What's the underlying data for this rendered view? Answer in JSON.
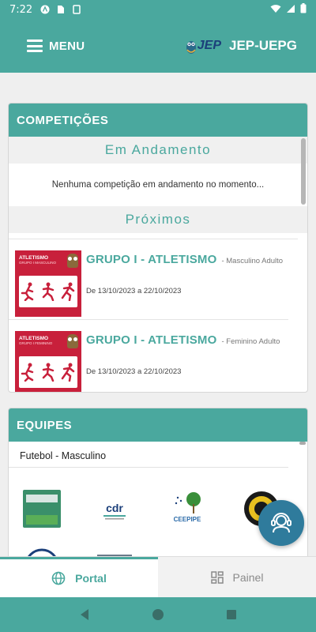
{
  "status_bar": {
    "time": "7:22"
  },
  "header": {
    "menu_label": "MENU",
    "logo_text": "JEP",
    "app_name": "JEP-UEPG"
  },
  "competicoes": {
    "title": "COMPETIÇÕES",
    "em_andamento": {
      "title": "Em Andamento",
      "empty_message": "Nenhuma competição em andamento no momento..."
    },
    "proximos": {
      "title": "Próximos",
      "items": [
        {
          "title": "GRUPO I - ATLETISMO",
          "category": "- Masculino Adulto",
          "dates": "De 13/10/2023 a 22/10/2023",
          "thumb_title": "ATLETISMO",
          "thumb_sub": "GRUPO I MASCULINO"
        },
        {
          "title": "GRUPO I - ATLETISMO",
          "category": "- Feminino Adulto",
          "dates": "De 13/10/2023 a 22/10/2023",
          "thumb_title": "ATLETISMO",
          "thumb_sub": "GRUPO I FEMININO"
        }
      ]
    }
  },
  "equipes": {
    "title": "EQUIPES",
    "category": "Futebol - Masculino",
    "team_logos": [
      {
        "name": "team-logo-building"
      },
      {
        "name": "team-logo-cdr",
        "text": "cdr"
      },
      {
        "name": "team-logo-ceepipe",
        "text": "CEEPIPE"
      },
      {
        "name": "team-logo-emblem"
      },
      {
        "name": "team-logo-seal"
      },
      {
        "name": "team-logo-stadium"
      }
    ]
  },
  "tabs": [
    {
      "label": "Portal",
      "icon": "globe-icon",
      "active": true
    },
    {
      "label": "Painel",
      "icon": "dashboard-icon",
      "active": false
    }
  ],
  "colors": {
    "primary": "#4aa89e",
    "thumb_red": "#c8203b",
    "fab": "#2f7b9c"
  }
}
